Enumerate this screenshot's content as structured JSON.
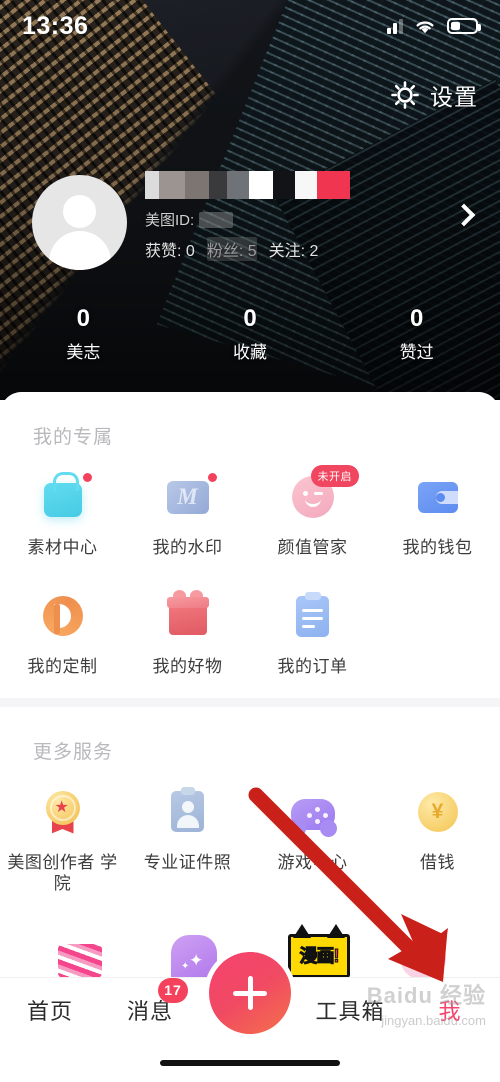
{
  "status_bar": {
    "time": "13:36",
    "signal_icon": "signal-bars-icon",
    "wifi_icon": "wifi-icon",
    "battery_icon": "battery-icon"
  },
  "header": {
    "settings_label": "设置",
    "settings_icon": "gear-icon",
    "chevron_icon": "chevron-right-icon",
    "avatar_icon": "default-avatar-icon",
    "username_masked": "（已打码）",
    "meitu_id_label": "美图ID:",
    "meitu_id_value": "",
    "likes_label": "获赞:",
    "likes_value": "0",
    "fans_label": "粉丝:",
    "fans_value": "5",
    "following_label": "关注:",
    "following_value": "2"
  },
  "counters": [
    {
      "value": "0",
      "label": "美志"
    },
    {
      "value": "0",
      "label": "收藏"
    },
    {
      "value": "0",
      "label": "赞过"
    }
  ],
  "sections": [
    {
      "title": "我的专属",
      "items": [
        {
          "label": "素材中心",
          "icon": "shopping-bag-icon",
          "badge_dot": true
        },
        {
          "label": "我的水印",
          "icon": "watermark-m-icon",
          "badge_dot": true
        },
        {
          "label": "颜值管家",
          "icon": "smiley-face-icon",
          "badge_text": "未开启"
        },
        {
          "label": "我的钱包",
          "icon": "wallet-icon"
        },
        {
          "label": "我的定制",
          "icon": "letter-d-icon"
        },
        {
          "label": "我的好物",
          "icon": "gift-box-icon"
        },
        {
          "label": "我的订单",
          "icon": "clipboard-list-icon"
        }
      ]
    },
    {
      "title": "更多服务",
      "items": [
        {
          "label": "美图创作者\n学院",
          "icon": "medal-star-icon"
        },
        {
          "label": "专业证件照",
          "icon": "id-photo-icon"
        },
        {
          "label": "游戏中心",
          "icon": "gamepad-icon"
        },
        {
          "label": "借钱",
          "icon": "yuan-coin-icon"
        }
      ]
    }
  ],
  "peek_row": {
    "manga_label": "漫画!",
    "icons": [
      "nail-art-icon",
      "magic-wand-icon",
      "plus-circle-icon",
      "manga-icon",
      "bubble-d-icon"
    ]
  },
  "bottom_nav": {
    "items": [
      {
        "label": "首页",
        "active": false
      },
      {
        "label": "消息",
        "active": false,
        "badge": "17"
      },
      {
        "label": "工具箱",
        "active": false
      },
      {
        "label": "我",
        "active": true
      }
    ],
    "center_button_icon": "plus-icon"
  },
  "annotation": {
    "arrow_color": "#c9211a",
    "points_to": "我"
  },
  "watermark": {
    "main": "Baidu 经验",
    "sub": "jingyan.baidu.com"
  },
  "colors": {
    "accent_pink": "#f5456e",
    "badge_red": "#f5425c",
    "sheet_bg": "#ffffff",
    "divider": "#f5f5f7",
    "section_title": "#b9b9bd"
  }
}
